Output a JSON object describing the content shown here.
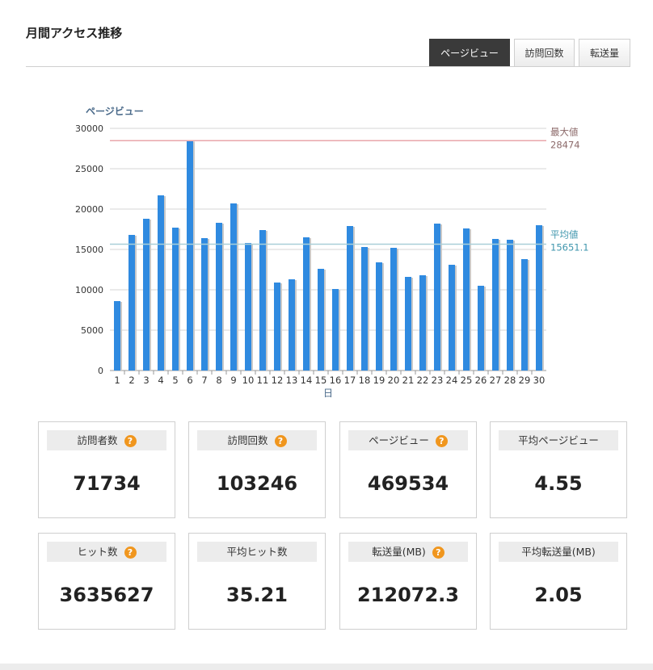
{
  "header": {
    "title": "月間アクセス推移"
  },
  "tabs": [
    {
      "label": "ページビュー",
      "active": true
    },
    {
      "label": "訪問回数",
      "active": false
    },
    {
      "label": "転送量",
      "active": false
    }
  ],
  "chart_data": {
    "type": "bar",
    "ylabel": "ページビュー",
    "xlabel": "日",
    "ylim": [
      0,
      30000
    ],
    "yticks": [
      0,
      5000,
      10000,
      15000,
      20000,
      25000,
      30000
    ],
    "categories": [
      "1",
      "2",
      "3",
      "4",
      "5",
      "6",
      "7",
      "8",
      "9",
      "10",
      "11",
      "12",
      "13",
      "14",
      "15",
      "16",
      "17",
      "18",
      "19",
      "20",
      "21",
      "22",
      "23",
      "24",
      "25",
      "26",
      "27",
      "28",
      "29",
      "30"
    ],
    "values": [
      8600,
      16800,
      18800,
      21700,
      17700,
      28474,
      16400,
      18300,
      20700,
      15800,
      17400,
      10900,
      11300,
      16500,
      12600,
      10100,
      17900,
      15300,
      13400,
      15200,
      11600,
      11800,
      18200,
      13100,
      17600,
      10500,
      16300,
      16200,
      13800,
      18000
    ],
    "bar_color": "#2f8ae0",
    "grid": true,
    "reference_lines": [
      {
        "label": "最大値",
        "value_text": "28474",
        "value": 28474,
        "color": "#e8a6aa",
        "text_color": "#8c6a6a"
      },
      {
        "label": "平均値",
        "value_text": "15651.1",
        "value": 15651.1,
        "color": "#a9cfd8",
        "text_color": "#3f96ad"
      }
    ]
  },
  "stats": [
    {
      "label": "訪問者数",
      "value": "71734",
      "help": "?"
    },
    {
      "label": "訪問回数",
      "value": "103246",
      "help": "?"
    },
    {
      "label": "ページビュー",
      "value": "469534",
      "help": "?"
    },
    {
      "label": "平均ページビュー",
      "value": "4.55"
    },
    {
      "label": "ヒット数",
      "value": "3635627",
      "help": "?"
    },
    {
      "label": "平均ヒット数",
      "value": "35.21"
    },
    {
      "label": "転送量(MB)",
      "value": "212072.3",
      "help": "?"
    },
    {
      "label": "平均転送量(MB)",
      "value": "2.05"
    }
  ],
  "colors": {
    "accent": "#2f8ae0",
    "help_icon": "#f0961e",
    "active_tab": "#3a3a3a"
  }
}
